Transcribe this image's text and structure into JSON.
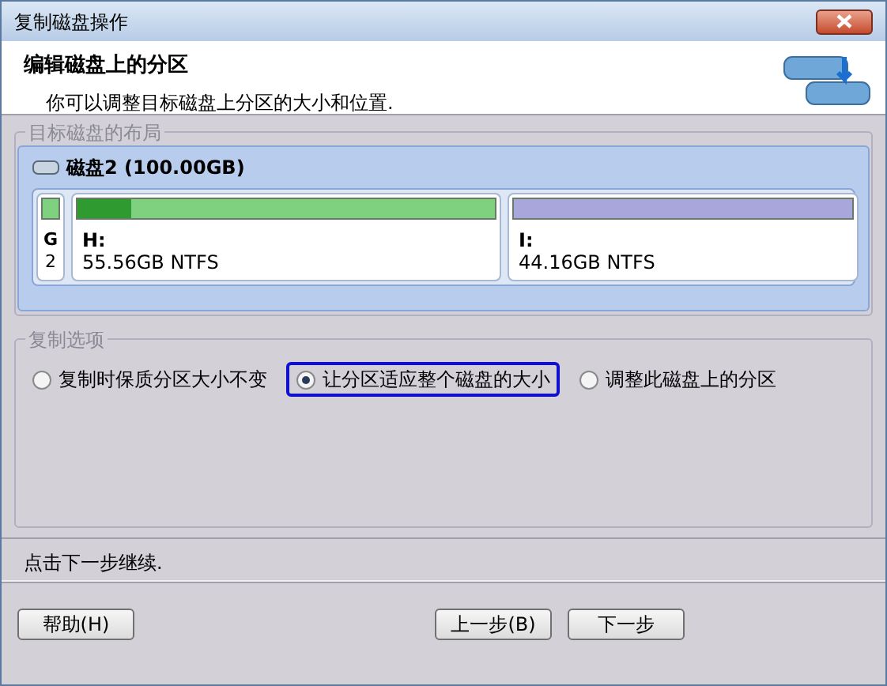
{
  "window": {
    "title": "复制磁盘操作"
  },
  "header": {
    "title": "编辑磁盘上的分区",
    "subtitle": "你可以调整目标磁盘上分区的大小和位置."
  },
  "layout_group": {
    "label": "目标磁盘的布局",
    "disk": "磁盘2 (100.00GB)",
    "partitions": [
      {
        "letter": "G",
        "info": "2",
        "color": "#7fd07f"
      },
      {
        "letter": "H:",
        "info": "55.56GB NTFS",
        "color": "#7fd07f",
        "level": 0.13
      },
      {
        "letter": "I:",
        "info": "44.16GB NTFS",
        "color": "#a9a6dc"
      }
    ]
  },
  "options_group": {
    "label": "复制选项",
    "options": [
      {
        "label": "复制时保质分区大小不变",
        "selected": false
      },
      {
        "label": "让分区适应整个磁盘的大小",
        "selected": true
      },
      {
        "label": "调整此磁盘上的分区",
        "selected": false
      }
    ]
  },
  "status_text": "点击下一步继续.",
  "buttons": [
    {
      "label": "帮助(H)"
    },
    {
      "label": "上一步(B)"
    },
    {
      "label": "下一步"
    }
  ]
}
